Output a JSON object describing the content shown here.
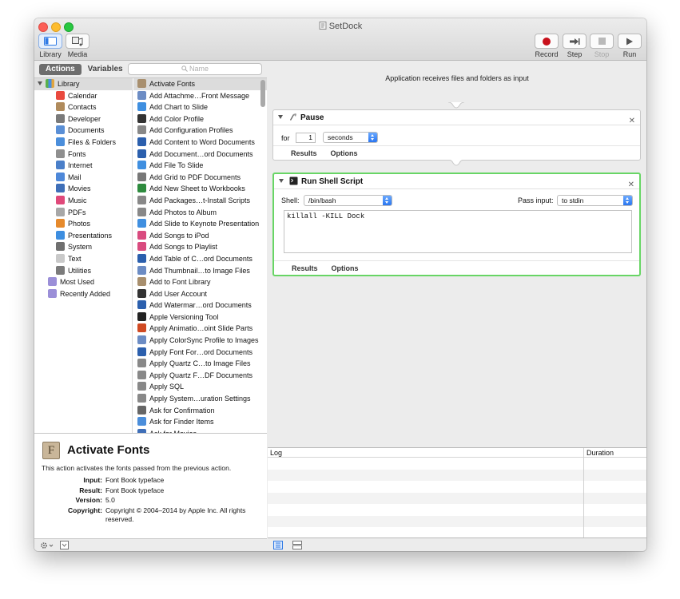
{
  "window": {
    "title": "SetDock"
  },
  "toolbar": {
    "library_label": "Library",
    "media_label": "Media",
    "record_label": "Record",
    "step_label": "Step",
    "stop_label": "Stop",
    "run_label": "Run"
  },
  "left": {
    "tab_actions": "Actions",
    "tab_variables": "Variables",
    "search_placeholder": "Name"
  },
  "library": {
    "root": "Library",
    "items": [
      {
        "label": "Calendar",
        "color": "#e9493e"
      },
      {
        "label": "Contacts",
        "color": "#b08b5c"
      },
      {
        "label": "Developer",
        "color": "#7a7a7a"
      },
      {
        "label": "Documents",
        "color": "#5a8fd6"
      },
      {
        "label": "Files & Folders",
        "color": "#4b8edb"
      },
      {
        "label": "Fonts",
        "color": "#8f8f8f"
      },
      {
        "label": "Internet",
        "color": "#4a7fc9"
      },
      {
        "label": "Mail",
        "color": "#4e88d9"
      },
      {
        "label": "Movies",
        "color": "#3f6fb8"
      },
      {
        "label": "Music",
        "color": "#e0497a"
      },
      {
        "label": "PDFs",
        "color": "#a7a7a7"
      },
      {
        "label": "Photos",
        "color": "#e68a2c"
      },
      {
        "label": "Presentations",
        "color": "#3d8ee0"
      },
      {
        "label": "System",
        "color": "#6f6f6f"
      },
      {
        "label": "Text",
        "color": "#c9c9c9"
      },
      {
        "label": "Utilities",
        "color": "#7b7b7b"
      }
    ],
    "groups": [
      {
        "label": "Most Used",
        "color": "#9b8fd8"
      },
      {
        "label": "Recently Added",
        "color": "#9b8fd8"
      }
    ]
  },
  "actions": [
    {
      "label": "Activate Fonts",
      "color": "#a88f6e"
    },
    {
      "label": "Add Attachme…Front Message",
      "color": "#6c8cc4"
    },
    {
      "label": "Add Chart to Slide",
      "color": "#3f8fe0"
    },
    {
      "label": "Add Color Profile",
      "color": "#333333"
    },
    {
      "label": "Add Configuration Profiles",
      "color": "#888888"
    },
    {
      "label": "Add Content to Word Documents",
      "color": "#2b5fad"
    },
    {
      "label": "Add Document…ord Documents",
      "color": "#2b5fad"
    },
    {
      "label": "Add File To Slide",
      "color": "#3f8fe0"
    },
    {
      "label": "Add Grid to PDF Documents",
      "color": "#777777"
    },
    {
      "label": "Add New Sheet to Workbooks",
      "color": "#2e8b3e"
    },
    {
      "label": "Add Packages…t-Install Scripts",
      "color": "#888888"
    },
    {
      "label": "Add Photos to Album",
      "color": "#888888"
    },
    {
      "label": "Add Slide to Keynote Presentation",
      "color": "#3f8fe0"
    },
    {
      "label": "Add Songs to iPod",
      "color": "#d94b7f"
    },
    {
      "label": "Add Songs to Playlist",
      "color": "#d94b7f"
    },
    {
      "label": "Add Table of C…ord Documents",
      "color": "#2b5fad"
    },
    {
      "label": "Add Thumbnail…to Image Files",
      "color": "#6c8cc4"
    },
    {
      "label": "Add to Font Library",
      "color": "#a88f6e"
    },
    {
      "label": "Add User Account",
      "color": "#333333"
    },
    {
      "label": "Add Watermar…ord Documents",
      "color": "#2b5fad"
    },
    {
      "label": "Apple Versioning Tool",
      "color": "#222222"
    },
    {
      "label": "Apply Animatio…oint Slide Parts",
      "color": "#d04a23"
    },
    {
      "label": "Apply ColorSync Profile to Images",
      "color": "#6c8cc4"
    },
    {
      "label": "Apply Font For…ord Documents",
      "color": "#2b5fad"
    },
    {
      "label": "Apply Quartz C…to Image Files",
      "color": "#888888"
    },
    {
      "label": "Apply Quartz F…DF Documents",
      "color": "#888888"
    },
    {
      "label": "Apply SQL",
      "color": "#888888"
    },
    {
      "label": "Apply System…uration Settings",
      "color": "#888888"
    },
    {
      "label": "Ask for Confirmation",
      "color": "#666666"
    },
    {
      "label": "Ask for Finder Items",
      "color": "#4b8edb"
    },
    {
      "label": "Ask for Movies",
      "color": "#3f6fb8"
    }
  ],
  "description": {
    "title": "Activate Fonts",
    "text": "This action activates the fonts passed from the previous action.",
    "input_key": "Input:",
    "input_val": "Font Book typeface",
    "result_key": "Result:",
    "result_val": "Font Book typeface",
    "version_key": "Version:",
    "version_val": "5.0",
    "copyright_key": "Copyright:",
    "copyright_val": "Copyright © 2004–2014 by Apple Inc. All rights reserved."
  },
  "workflow": {
    "input_info": "Application receives files and folders as input",
    "pause": {
      "title": "Pause",
      "for_label": "for",
      "value": "1",
      "unit": "seconds",
      "results": "Results",
      "options": "Options"
    },
    "shell": {
      "title": "Run Shell Script",
      "shell_label": "Shell:",
      "shell_value": "/bin/bash",
      "pass_label": "Pass input:",
      "pass_value": "to stdin",
      "script": "killall -KILL Dock",
      "results": "Results",
      "options": "Options"
    }
  },
  "log": {
    "col_log": "Log",
    "col_duration": "Duration"
  }
}
